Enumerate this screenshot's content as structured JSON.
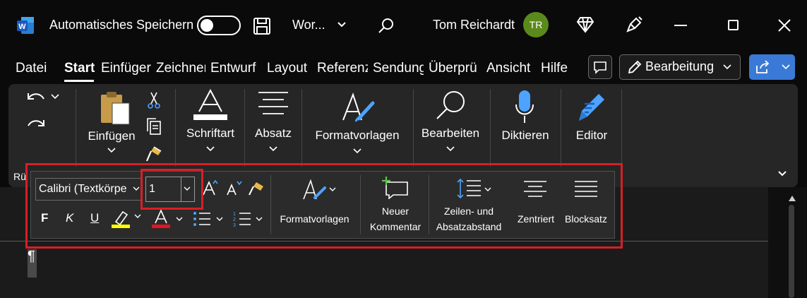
{
  "titlebar": {
    "app_icon": "word-logo",
    "autosave_label": "Automatisches Speichern",
    "autosave_state": "off",
    "doc_name": "Wor...",
    "user_name": "Tom Reichardt",
    "user_initials": "TR"
  },
  "menu": {
    "tabs": [
      "Datei",
      "Start",
      "Einfüger",
      "Zeichnen",
      "Entwurf",
      "Layout",
      "Referenz",
      "Sendung",
      "Überprü",
      "Ansicht",
      "Hilfe"
    ],
    "active_tab": "Start",
    "edit_mode_label": "Bearbeitung"
  },
  "ribbon": {
    "paste_label": "Einfügen",
    "font_label": "Schriftart",
    "paragraph_label": "Absatz",
    "styles_label": "Formatvorlagen",
    "editing_label": "Bearbeiten",
    "dictate_label": "Diktieren",
    "editor_label": "Editor",
    "group_cut_label": "Rü"
  },
  "floatbar": {
    "font_name": "Calibri (Textkörpe",
    "font_size": "1",
    "styles_label": "Formatvorlagen",
    "new_comment_line1": "Neuer",
    "new_comment_line2": "Kommentar",
    "spacing_line1": "Zeilen- und",
    "spacing_line2": "Absatzabstand",
    "center_label": "Zentriert",
    "justify_label": "Blocksatz",
    "bold_glyph": "F",
    "italic_glyph": "K",
    "underline_glyph": "U",
    "highlight_color": "#ffff00",
    "font_color": "#e81123"
  },
  "document": {
    "pilcrow": "¶"
  },
  "colors": {
    "accent_share": "#3a7ad6",
    "highlight_box": "#d71f26",
    "avatar": "#5b8a1c"
  }
}
